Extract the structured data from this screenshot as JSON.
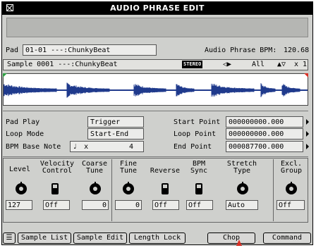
{
  "title": "AUDIO PHRASE EDIT",
  "pad": {
    "label": "Pad",
    "value": "01-01 ---:ChunkyBeat"
  },
  "bpm": {
    "label": "Audio Phrase BPM:",
    "value": "120.68"
  },
  "sample": {
    "value": "Sample 0001 ---:ChunkyBeat",
    "stereo_badge": "STEREO",
    "channel": "All",
    "zoom": "x 1"
  },
  "params": {
    "pad_play_label": "Pad Play",
    "pad_play": "Trigger",
    "loop_mode_label": "Loop Mode",
    "loop_mode": "Start-End",
    "bpm_base_note_label": "BPM Base Note",
    "bpm_base_note_symbol": "♩",
    "bpm_base_note_x": "x",
    "bpm_base_note_value": "4",
    "start_point_label": "Start Point",
    "start_point": "000000000.000",
    "loop_point_label": "Loop Point",
    "loop_point": "000000000.000",
    "end_point_label": "End Point",
    "end_point": "000087700.000"
  },
  "controls": {
    "level_label": "Level",
    "level": "127",
    "velocity_label": "Velocity\nControl",
    "velocity": "Off",
    "coarse_label": "Coarse\nTune",
    "coarse": "0",
    "fine_label": "Fine\nTune",
    "fine": "0",
    "reverse_label": "Reverse",
    "reverse": "Off",
    "bpm_sync_label": "BPM\nSync",
    "bpm_sync": "Off",
    "stretch_label": "Stretch\nType",
    "stretch": "Auto",
    "excl_label": "Excl.\nGroup",
    "excl": "Off"
  },
  "buttons": {
    "sample_list": "Sample List",
    "sample_edit": "Sample Edit",
    "length_lock": "Length Lock",
    "chop": "Chop",
    "command": "Command"
  },
  "colors": {
    "title_bg": "#000000",
    "panel": "#cfd0cd",
    "waveform": "#1f3a8c",
    "start_marker": "#2ea043",
    "end_marker": "#d93025",
    "cursor": "#d93025"
  }
}
